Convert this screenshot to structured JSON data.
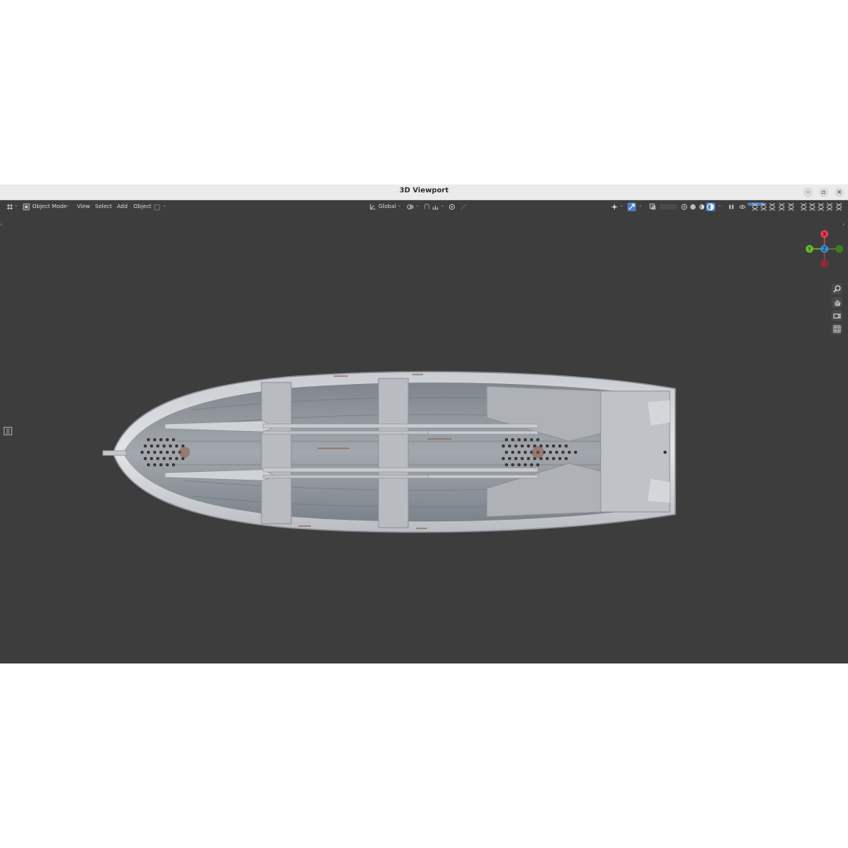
{
  "window": {
    "title": "3D Viewport",
    "controls": {
      "minimize": "–",
      "maximize": "▫",
      "close": "×"
    }
  },
  "header": {
    "mode_label": "Object Mode",
    "menus": [
      "View",
      "Select",
      "Add",
      "Object"
    ],
    "transform_orientation": "Global"
  },
  "navigation_gizmo": {
    "axes": {
      "x": "X",
      "y": "Y",
      "z": "Z"
    },
    "colors": {
      "x": "#e0404f",
      "y": "#6ab82e",
      "z": "#3f8cd9"
    }
  },
  "viewport_tools": [
    "zoom-icon",
    "hand-pan-icon",
    "camera-icon",
    "grid-icon"
  ],
  "colors": {
    "viewport_bg": "#3d3d3d",
    "titlebar_bg": "#ebebeb",
    "active_blue": "#4a7fc1"
  }
}
